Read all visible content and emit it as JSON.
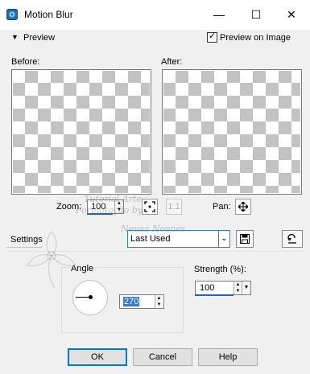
{
  "window": {
    "title": "Motion Blur",
    "minimize": "—",
    "maximize": "☐",
    "close": "✕"
  },
  "preview": {
    "section_label": "Preview",
    "checkbox_label": "Preview on Image",
    "checked": true,
    "before_label": "Before:",
    "after_label": "After:"
  },
  "zoom": {
    "label": "Zoom:",
    "value": "100",
    "fit_button_icon": "fit-icon",
    "actual_size_button_text": "1:1",
    "pan_label": "Pan:",
    "pan_icon": "move-icon"
  },
  "settings": {
    "label": "Settings",
    "preset_value": "Last Used",
    "save_icon": "save-icon",
    "reset_icon": "reset-icon"
  },
  "angle": {
    "label": "Angle",
    "value": "270"
  },
  "strength": {
    "label": "Strength (%):",
    "value": "100"
  },
  "buttons": {
    "ok": "OK",
    "cancel": "Cancel",
    "help": "Help"
  },
  "watermark": {
    "lines": [
      "Tutorial Arte",
      "Formatação by",
      "Neusa Novaes"
    ]
  },
  "colors": {
    "accent": "#0078d7",
    "selection": "#3a78d4",
    "checker": "#c3c3c3"
  }
}
